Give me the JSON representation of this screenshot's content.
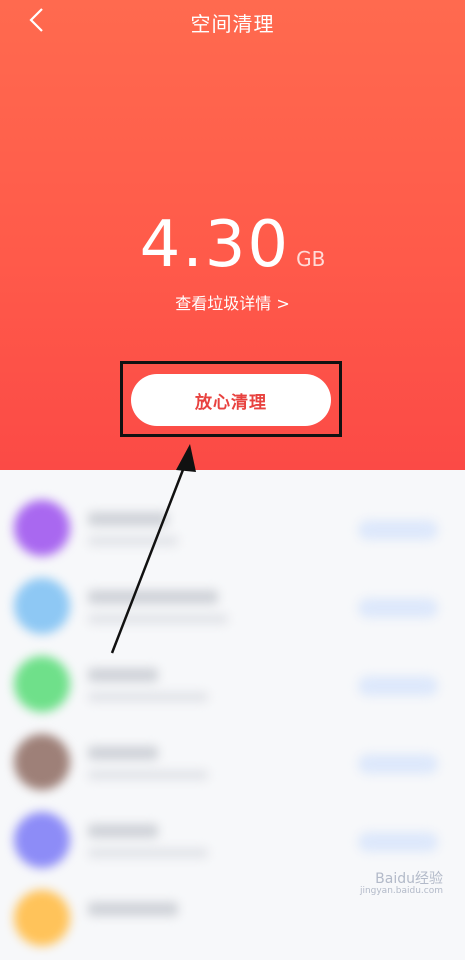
{
  "header": {
    "title": "空间清理",
    "back_icon": "chevron-left-icon"
  },
  "summary": {
    "size_value": "4.30",
    "size_unit": "GB",
    "detail_link": "查看垃圾详情 >"
  },
  "action": {
    "clean_label": "放心清理"
  },
  "list_items": [
    {
      "avatar_color": "#a968f0"
    },
    {
      "avatar_color": "#8ec8f4"
    },
    {
      "avatar_color": "#6fe08a"
    },
    {
      "avatar_color": "#9e8078"
    },
    {
      "avatar_color": "#8d8cf7"
    },
    {
      "avatar_color": "#ffc35a"
    }
  ],
  "watermark": {
    "text": "Baidu经验",
    "sub": "jingyan.baidu.com"
  },
  "colors": {
    "hero_top": "#ff6a4f",
    "hero_bottom": "#fb4a46",
    "accent_text": "#e8423f"
  }
}
